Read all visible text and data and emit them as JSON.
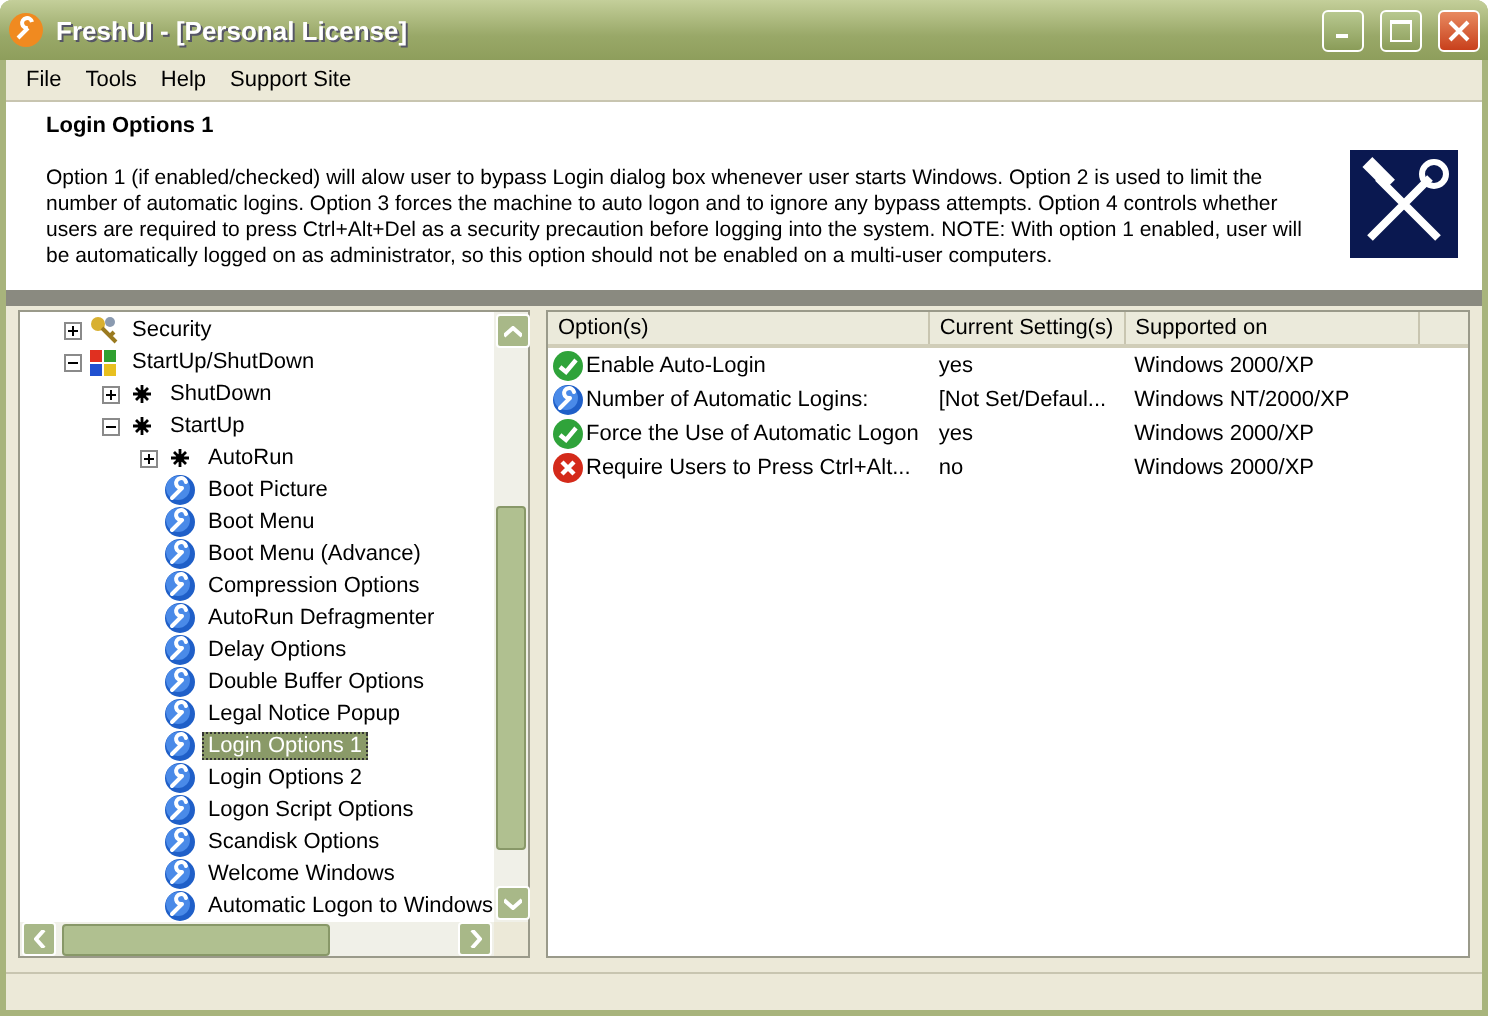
{
  "window": {
    "title": "FreshUI - [Personal License]"
  },
  "menu": [
    "File",
    "Tools",
    "Help",
    "Support Site"
  ],
  "description": {
    "title": "Login Options 1",
    "text": "Option 1 (if enabled/checked) will alow user to bypass Login dialog box whenever user starts Windows. Option 2 is used to limit the number of automatic logins. Option 3 forces the machine to auto logon and to ignore any bypass attempts. Option 4 controls whether users are required to press Ctrl+Alt+Del as a security precaution before logging into the system. NOTE: With option 1 enabled, user will be automatically logged on as administrator, so this option should not be enabled on a multi-user computers."
  },
  "tree": [
    {
      "label": "Security",
      "kind": "keys",
      "expanded": false,
      "selected": false
    },
    {
      "label": "StartUp/ShutDown",
      "kind": "flag",
      "expanded": true,
      "selected": false,
      "children": [
        {
          "label": "ShutDown",
          "kind": "gear",
          "expanded": false,
          "selected": false
        },
        {
          "label": "StartUp",
          "kind": "gear",
          "expanded": true,
          "selected": false,
          "children": [
            {
              "label": "AutoRun",
              "kind": "gear",
              "expanded": false,
              "selected": false
            },
            {
              "label": "Boot Picture",
              "kind": "wrench",
              "selected": false
            },
            {
              "label": "Boot Menu",
              "kind": "wrench",
              "selected": false
            },
            {
              "label": "Boot Menu (Advance)",
              "kind": "wrench",
              "selected": false
            },
            {
              "label": "Compression Options",
              "kind": "wrench",
              "selected": false
            },
            {
              "label": "AutoRun Defragmenter",
              "kind": "wrench",
              "selected": false
            },
            {
              "label": "Delay Options",
              "kind": "wrench",
              "selected": false
            },
            {
              "label": "Double Buffer Options",
              "kind": "wrench",
              "selected": false
            },
            {
              "label": "Legal Notice Popup",
              "kind": "wrench",
              "selected": false
            },
            {
              "label": "Login Options 1",
              "kind": "wrench",
              "selected": true
            },
            {
              "label": "Login Options 2",
              "kind": "wrench",
              "selected": false
            },
            {
              "label": "Logon Script Options",
              "kind": "wrench",
              "selected": false
            },
            {
              "label": "Scandisk Options",
              "kind": "wrench",
              "selected": false
            },
            {
              "label": "Welcome Windows",
              "kind": "wrench",
              "selected": false
            },
            {
              "label": "Automatic Logon to Windows",
              "kind": "wrench",
              "selected": false
            }
          ]
        }
      ]
    }
  ],
  "table": {
    "columns": [
      "Option(s)",
      "Current Setting(s)",
      "Supported on"
    ],
    "rows": [
      {
        "kind": "ok",
        "option": "Enable Auto-Login",
        "setting": "yes",
        "supported": "Windows 2000/XP"
      },
      {
        "kind": "wrench",
        "option": "Number of Automatic Logins:",
        "setting": "[Not Set/Defaul...",
        "supported": "Windows NT/2000/XP"
      },
      {
        "kind": "ok",
        "option": "Force the Use of Automatic Logon",
        "setting": "yes",
        "supported": "Windows 2000/XP"
      },
      {
        "kind": "error",
        "option": "Require Users to Press Ctrl+Alt...",
        "setting": "no",
        "supported": "Windows 2000/XP"
      }
    ]
  }
}
